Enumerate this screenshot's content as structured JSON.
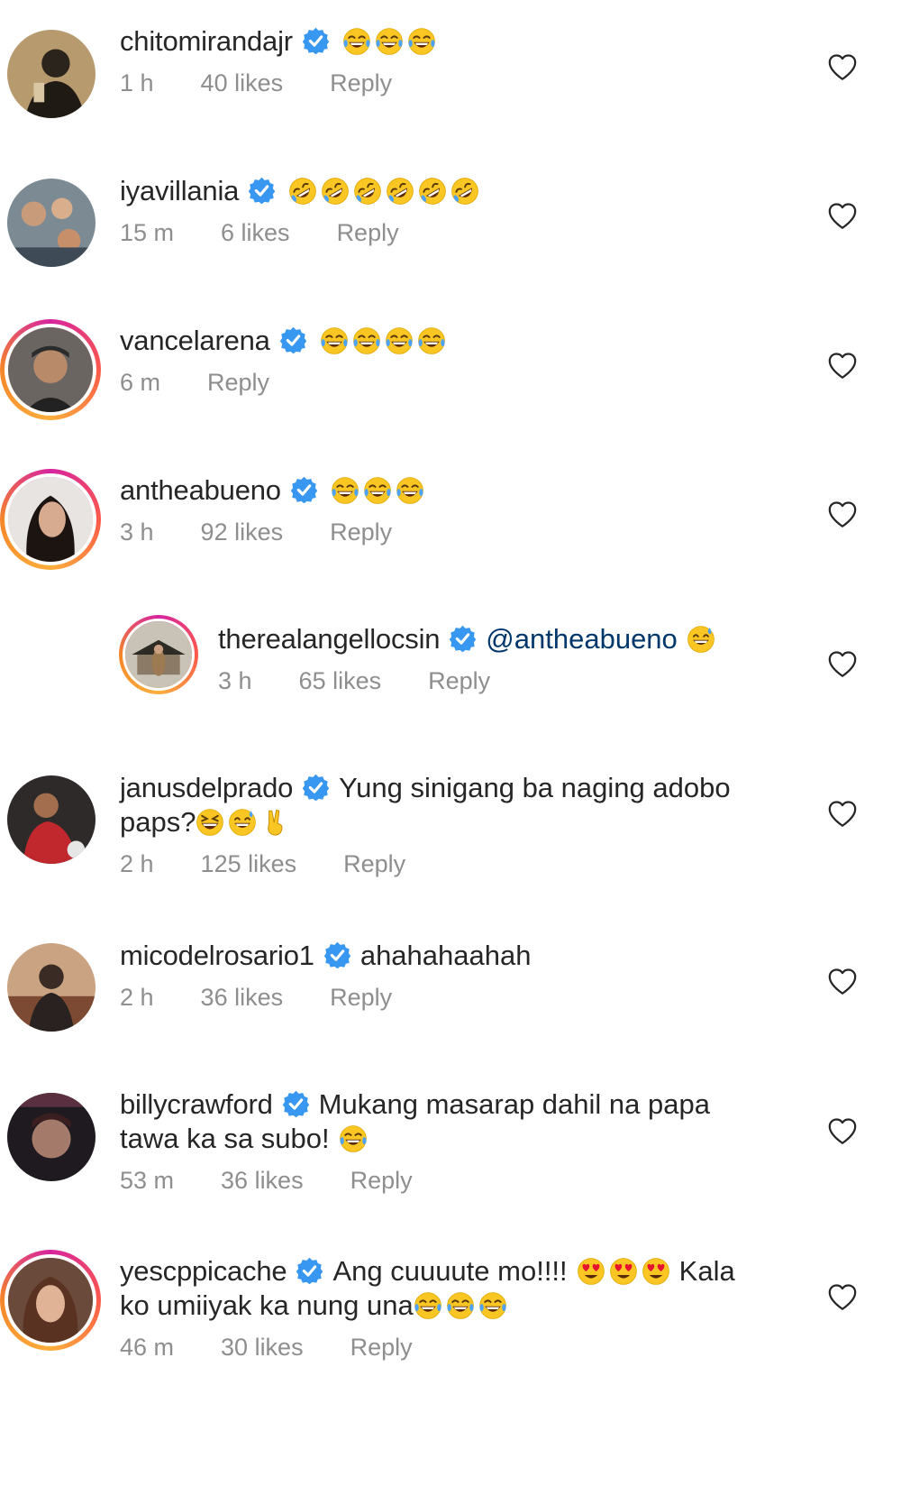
{
  "comments": [
    {
      "username": "chitomirandajr",
      "text": "",
      "emoji": [
        "joy",
        "joy",
        "joy"
      ],
      "time": "1 h",
      "likes": "40 likes",
      "reply": "Reply"
    },
    {
      "username": "iyavillania",
      "text": "",
      "emoji": [
        "rofl",
        "rofl",
        "rofl",
        "rofl",
        "rofl",
        "rofl"
      ],
      "time": "15 m",
      "likes": "6 likes",
      "reply": "Reply"
    },
    {
      "username": "vancelarena",
      "text": "",
      "emoji": [
        "joy",
        "joy",
        "joy",
        "joy"
      ],
      "time": "6 m",
      "likes": "",
      "reply": "Reply"
    },
    {
      "username": "antheabueno",
      "text": "",
      "emoji": [
        "joy",
        "joy",
        "joy"
      ],
      "time": "3 h",
      "likes": "92 likes",
      "reply": "Reply"
    },
    {
      "username": "therealangellocsin",
      "mention": "@antheabueno",
      "text": "",
      "emoji": [
        "sweat_smile"
      ],
      "time": "3 h",
      "likes": "65 likes",
      "reply": "Reply"
    },
    {
      "username": "janusdelprado",
      "text": "Yung sinigang ba naging adobo",
      "text2": "paps?",
      "emoji2": [
        "laughing",
        "sweat_smile",
        "victory"
      ],
      "time": "2 h",
      "likes": "125 likes",
      "reply": "Reply"
    },
    {
      "username": "micodelrosario1",
      "text": "ahahahaahah",
      "emoji": [],
      "time": "2 h",
      "likes": "36 likes",
      "reply": "Reply"
    },
    {
      "username": "billycrawford",
      "text": "Mukang masarap dahil na papa",
      "text2": "tawa ka sa subo!",
      "emoji2": [
        "joy"
      ],
      "time": "53 m",
      "likes": "36 likes",
      "reply": "Reply"
    },
    {
      "username": "yescppicache",
      "text": "Ang cuuuute mo!!!!",
      "emoji": [
        "heart_eyes",
        "heart_eyes",
        "heart_eyes"
      ],
      "text_after": "Kala",
      "text2": "ko umiiyak ka nung una",
      "emoji2": [
        "joy",
        "joy",
        "joy"
      ],
      "time": "46 m",
      "likes": "30 likes",
      "reply": "Reply"
    }
  ],
  "colors": {
    "verified": "#3897f0",
    "meta": "#8e8e8e",
    "mention": "#00376b",
    "emoji_face": "#f9c623"
  }
}
